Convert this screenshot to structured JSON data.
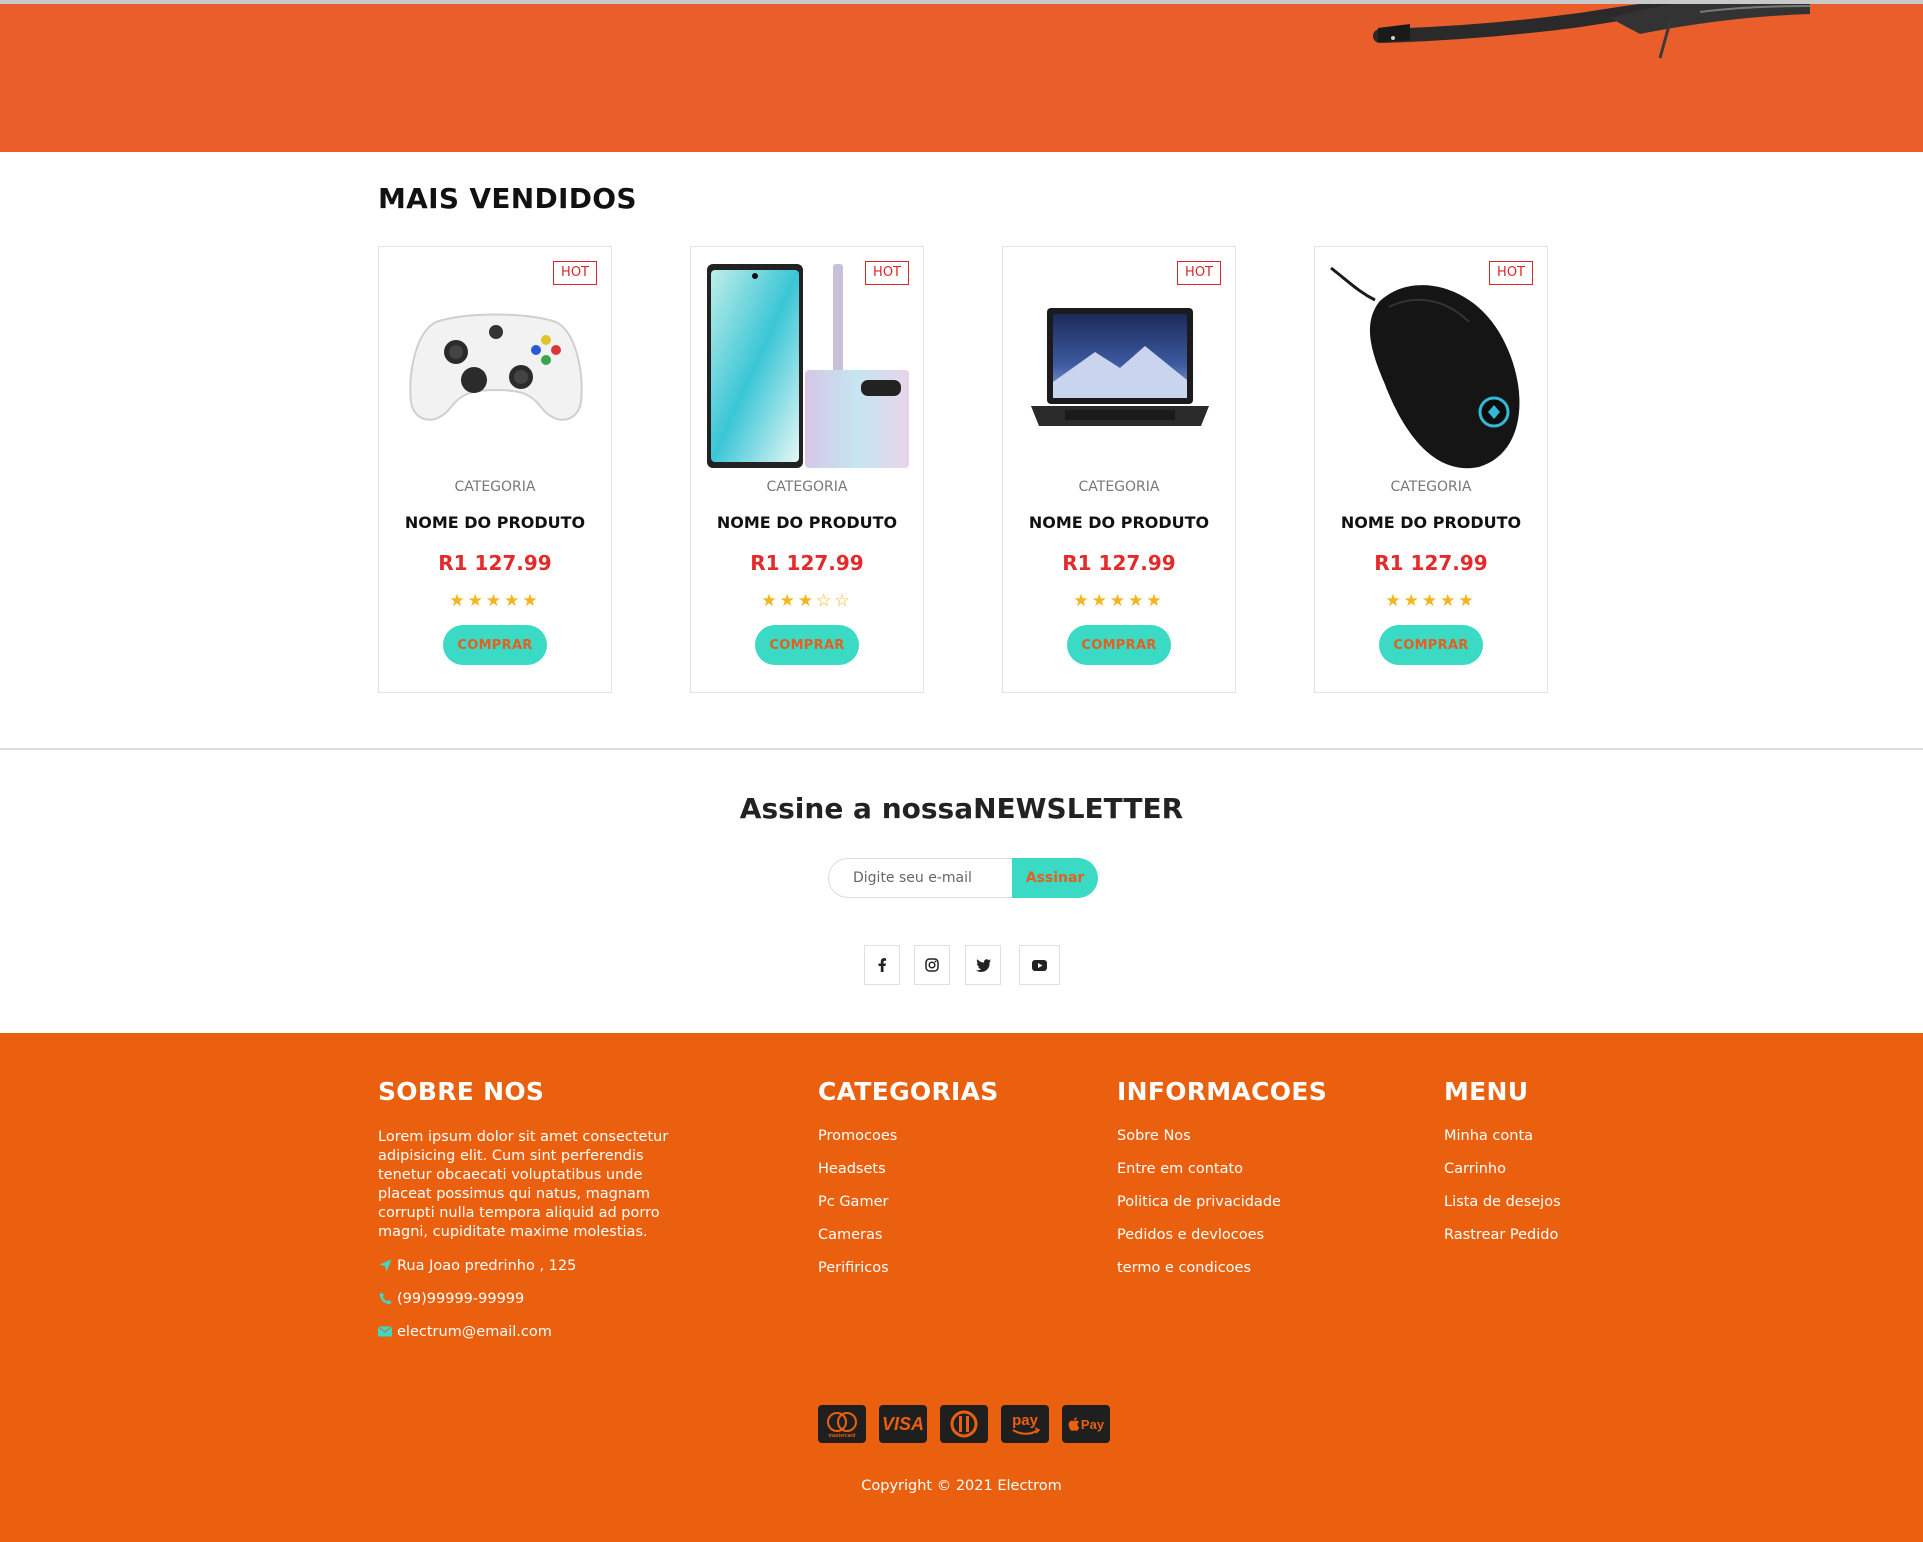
{
  "section": {
    "title": "MAIS VENDIDOS"
  },
  "products": [
    {
      "badge": "HOT",
      "category": "CATEGORIA",
      "name": "NOME DO PRODUTO",
      "price": "R1 127.99",
      "rating": 5,
      "buy_label": "COMPRAR",
      "image_icon": "xbox-controller-image"
    },
    {
      "badge": "HOT",
      "category": "CATEGORIA",
      "name": "NOME DO PRODUTO",
      "price": "R1 127.99",
      "rating": 3,
      "buy_label": "COMPRAR",
      "image_icon": "smartphone-image"
    },
    {
      "badge": "HOT",
      "category": "CATEGORIA",
      "name": "NOME DO PRODUTO",
      "price": "R1 127.99",
      "rating": 5,
      "buy_label": "COMPRAR",
      "image_icon": "laptop-image"
    },
    {
      "badge": "HOT",
      "category": "CATEGORIA",
      "name": "NOME DO PRODUTO",
      "price": "R1 127.99",
      "rating": 5,
      "buy_label": "COMPRAR",
      "image_icon": "gaming-mouse-image"
    }
  ],
  "newsletter": {
    "title": "Assine a nossaNEWSLETTER",
    "placeholder": "Digite seu e-mail",
    "button": "Assinar"
  },
  "social": [
    "facebook-icon",
    "instagram-icon",
    "twitter-icon",
    "youtube-icon"
  ],
  "footer": {
    "about": {
      "title": "SOBRE NOS",
      "text": "Lorem ipsum dolor sit amet consectetur adipisicing elit. Cum sint perferendis tenetur obcaecati voluptatibus unde placeat possimus qui natus, magnam corrupti nulla tempora aliquid ad porro magni, cupiditate maxime molestias.",
      "address": "Rua Joao predrinho , 125",
      "phone": "(99)99999-99999",
      "email": "electrum@email.com"
    },
    "categories": {
      "title": "CATEGORIAS",
      "items": [
        "Promocoes",
        "Headsets",
        "Pc Gamer",
        "Cameras",
        "Perifiricos"
      ]
    },
    "info": {
      "title": "INFORMACOES",
      "items": [
        "Sobre Nos",
        "Entre em contato",
        "Politica de privacidade",
        "Pedidos e devlocoes",
        "termo e condicoes"
      ]
    },
    "menu": {
      "title": "MENU",
      "items": [
        "Minha conta",
        "Carrinho",
        "Lista de desejos",
        "Rastrear Pedido"
      ]
    },
    "payments": [
      "mastercard-icon",
      "visa-icon",
      "diners-icon",
      "amazon-pay-icon",
      "apple-pay-icon"
    ],
    "payment_labels": {
      "visa": "VISA",
      "amazon": "pay",
      "apple": "Pay",
      "mastercard": "mastercard"
    },
    "copyright": "Copyright © 2021 Electrom"
  },
  "colors": {
    "hero": "#ea5e2c",
    "footer": "#ea600e",
    "accent": "#3bdac4",
    "price": "#e32b2b",
    "star": "#f2b51c"
  }
}
